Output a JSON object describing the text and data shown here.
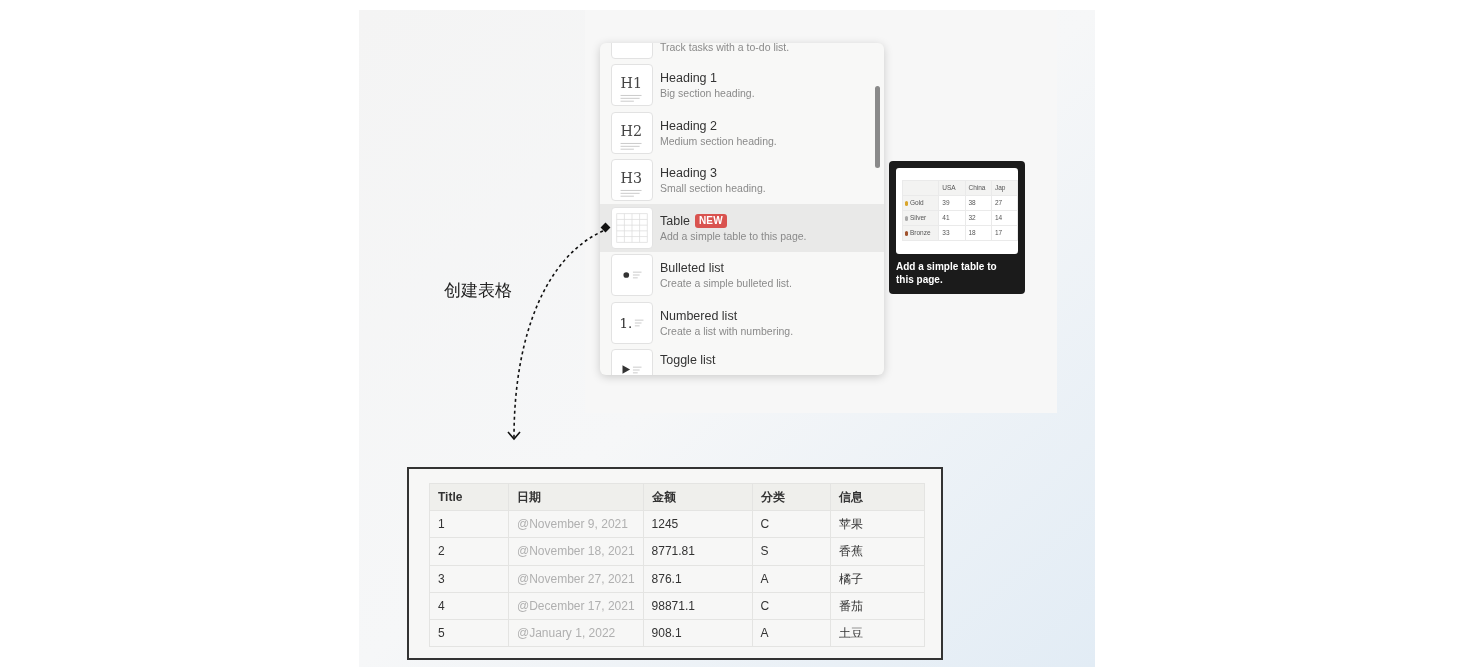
{
  "annotation": {
    "label": "创建表格"
  },
  "block_menu": {
    "items": [
      {
        "kind": "todo",
        "description": "Track tasks with a to-do list.",
        "selected": false
      },
      {
        "kind": "h1",
        "icon_text": "H1",
        "title": "Heading 1",
        "description": "Big section heading.",
        "selected": false
      },
      {
        "kind": "h2",
        "icon_text": "H2",
        "title": "Heading 2",
        "description": "Medium section heading.",
        "selected": false
      },
      {
        "kind": "h3",
        "icon_text": "H3",
        "title": "Heading 3",
        "description": "Small section heading.",
        "selected": false
      },
      {
        "kind": "table",
        "title": "Table",
        "badge": "NEW",
        "description": "Add a simple table to this page.",
        "selected": true
      },
      {
        "kind": "bullet",
        "title": "Bulleted list",
        "description": "Create a simple bulleted list.",
        "selected": false
      },
      {
        "kind": "number",
        "icon_text": "1.",
        "title": "Numbered list",
        "description": "Create a list with numbering.",
        "selected": false
      },
      {
        "kind": "toggle",
        "title": "Toggle list",
        "selected": false
      }
    ]
  },
  "preview": {
    "columns": [
      "USA",
      "China",
      "Jap"
    ],
    "rows": [
      {
        "label": "Gold",
        "color": "#d9a52b",
        "values": [
          "39",
          "38",
          "27"
        ]
      },
      {
        "label": "Silver",
        "color": "#a8a8a8",
        "values": [
          "41",
          "32",
          "14"
        ]
      },
      {
        "label": "Bronze",
        "color": "#a0522d",
        "values": [
          "33",
          "18",
          "17"
        ]
      }
    ],
    "caption": "Add a simple table to this page."
  },
  "table": {
    "columns": [
      "Title",
      "日期",
      "金额",
      "分类",
      "信息"
    ],
    "rows": [
      [
        "1",
        "@November 9, 2021",
        "1245",
        "C",
        "苹果"
      ],
      [
        "2",
        "@November 18, 2021",
        "8771.81",
        "S",
        "香蕉"
      ],
      [
        "3",
        "@November 27, 2021",
        "876.1",
        "A",
        "橘子"
      ],
      [
        "4",
        "@December 17, 2021",
        "98871.1",
        "C",
        "番茄"
      ],
      [
        "5",
        "@January 1, 2022",
        "908.1",
        "A",
        "土豆"
      ]
    ]
  }
}
